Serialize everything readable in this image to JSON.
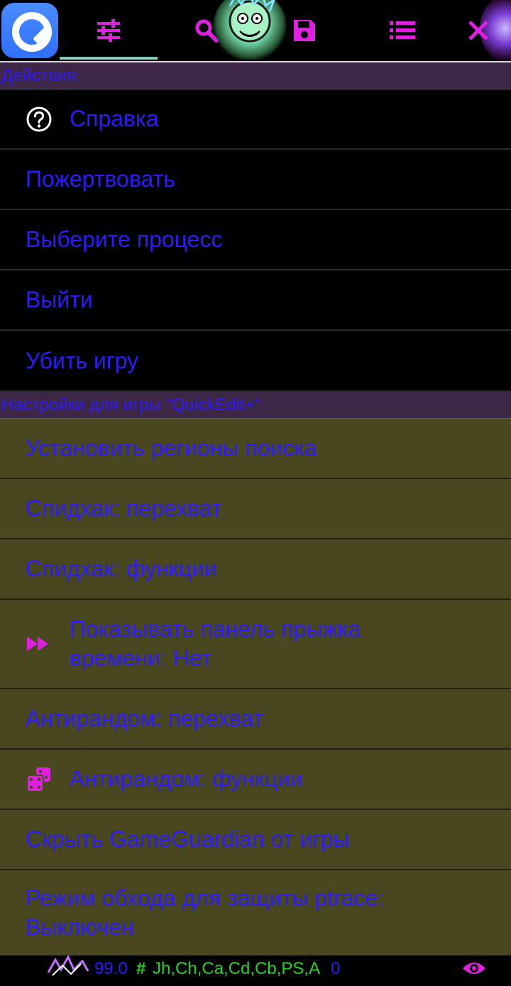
{
  "toolbar": {
    "tabs": [
      {
        "icon": "sliders-icon",
        "active": true
      },
      {
        "icon": "search-icon"
      },
      {
        "icon": "save-icon"
      },
      {
        "icon": "list-icon"
      },
      {
        "icon": "close-icon"
      }
    ],
    "accent": "#e020e0"
  },
  "sections": {
    "actions": {
      "header": "Действия:",
      "items": [
        {
          "label": "Справка",
          "icon": "help-circle-icon"
        },
        {
          "label": "Пожертвовать"
        },
        {
          "label": "Выберите процесс"
        },
        {
          "label": "Выйти"
        },
        {
          "label": "Убить игру"
        }
      ]
    },
    "game_settings": {
      "header": "Настройки для игры \"QuickEdit+\":",
      "items": [
        {
          "label": "Установить регионы поиска"
        },
        {
          "label": "Спидхак: перехват"
        },
        {
          "label": "Спидхак: функции"
        },
        {
          "label_line1": "Показывать панель прыжка",
          "label_line2": "времени: Нет",
          "icon": "fast-forward-icon"
        },
        {
          "label": "Антирандом: перехват"
        },
        {
          "label": "Антирандом: функции",
          "icon": "dice-icon"
        },
        {
          "label": "Скрыть GameGuardian от игры"
        },
        {
          "label_line1": "Режим обхода для защиты ptrace:",
          "label_line2": "Выключен"
        }
      ]
    }
  },
  "statusbar": {
    "speed": "99.0",
    "hash": "#",
    "flags": "Jh,Ch,Ca,Cd,Cb,PS,A",
    "count": "0",
    "eye_icon": "eye-icon"
  },
  "colors": {
    "text_blue": "#2d1aff",
    "header_bg": "#3e2646",
    "olive_bg": "#484720",
    "magenta": "#e020e0",
    "green": "#2bd12b"
  }
}
